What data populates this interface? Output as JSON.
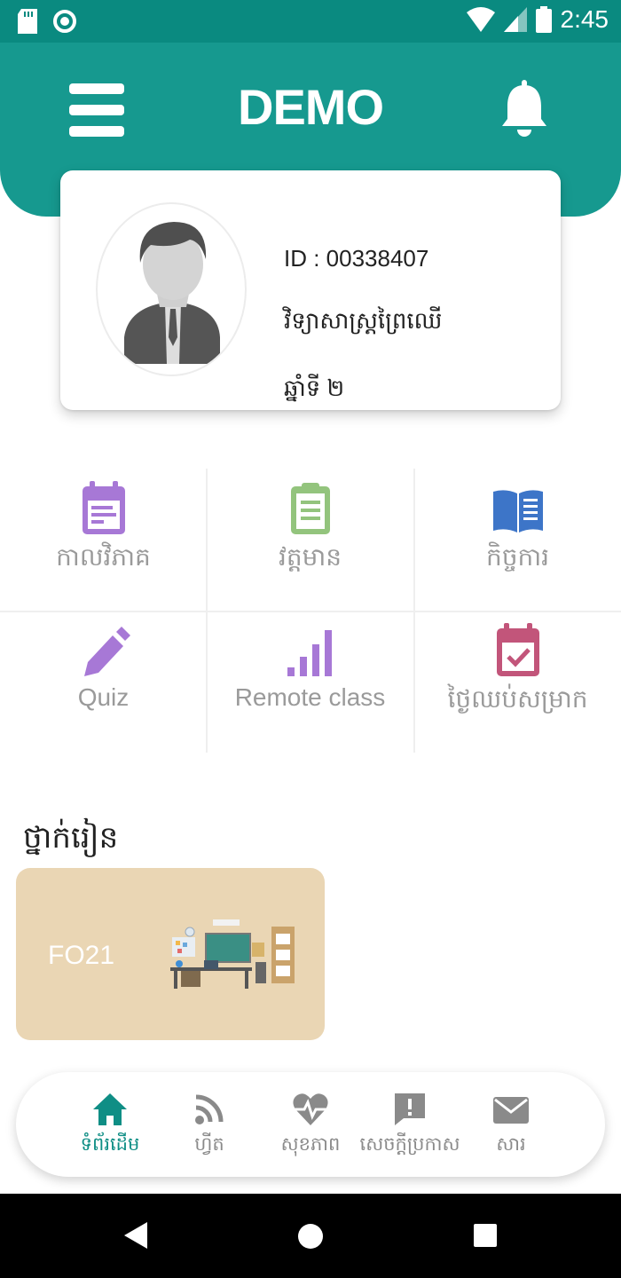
{
  "status_bar": {
    "time": "2:45"
  },
  "header": {
    "title": "DEMO"
  },
  "profile": {
    "id": "ID : 00338407",
    "faculty": "វិទ្យាសាស្រ្តព្រៃឈើ",
    "year": "ឆ្នាំទី ២"
  },
  "menu": {
    "items": [
      {
        "label": "កាលវិភាគ",
        "icon": "calendar-icon",
        "color": "#a778d6"
      },
      {
        "label": "វត្តមាន",
        "icon": "clipboard-icon",
        "color": "#93c47d"
      },
      {
        "label": "កិច្ចការ",
        "icon": "book-icon",
        "color": "#3d75c8"
      },
      {
        "label": "Quiz",
        "icon": "pencil-icon",
        "color": "#a778d6"
      },
      {
        "label": "Remote class",
        "icon": "signal-bars-icon",
        "color": "#a778d6"
      },
      {
        "label": "ថ្ងៃឈប់សម្រាក",
        "icon": "calendar-check-icon",
        "color": "#c2557a"
      }
    ]
  },
  "classes": {
    "title": "ថ្នាក់រៀន",
    "items": [
      {
        "name": "FO21"
      }
    ]
  },
  "bottom_nav": {
    "items": [
      {
        "label": "ទំព័រដើម",
        "icon": "home-icon",
        "active": true
      },
      {
        "label": "ហ្វីត",
        "icon": "rss-icon",
        "active": false
      },
      {
        "label": "សុខភាព",
        "icon": "heart-pulse-icon",
        "active": false
      },
      {
        "label": "សេចក្តីប្រកាស",
        "icon": "announcement-icon",
        "active": false
      },
      {
        "label": "សារ",
        "icon": "mail-icon",
        "active": false
      }
    ]
  },
  "colors": {
    "primary": "#16998f",
    "status_bar": "#0a8a80",
    "active_nav": "#0f8e85",
    "card_bg": "#ead6b4"
  }
}
